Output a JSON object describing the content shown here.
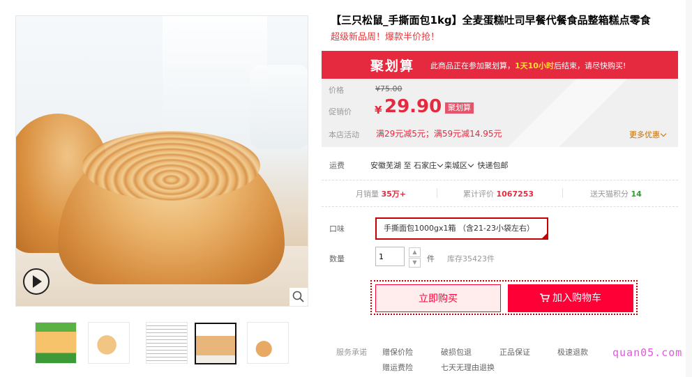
{
  "product": {
    "title": "【三只松鼠_手撕面包1kg】全麦蛋糕吐司早餐代餐食品整箱糕点零食",
    "subtitle": "超级新品周！爆款半价抢！"
  },
  "promo_banner": {
    "logo": "聚划算",
    "text_before": "此商品正在参加聚划算，",
    "highlight": "1天10小时",
    "text_after": "后结束，请尽快购买!"
  },
  "price": {
    "label": "价格",
    "original": "¥75.00",
    "promo_label": "促销价",
    "currency": "¥",
    "promo_value": "29.90",
    "tag": "聚划算",
    "activity_label": "本店活动",
    "activity_text": "满29元减5元；满59元减14.95元",
    "more_offers": "更多优惠"
  },
  "shipping": {
    "label": "运费",
    "origin": "安徽芜湖",
    "to": "至",
    "city": "石家庄",
    "district": "栾城区",
    "method": "快递包邮"
  },
  "stats": {
    "monthly_sales_label": "月销量",
    "monthly_sales_value": "35万+",
    "reviews_label": "累计评价",
    "reviews_value": "1067253",
    "points_label": "送天猫积分",
    "points_value": "14"
  },
  "options": {
    "flavor_label": "口味",
    "flavor_value": "手撕面包1000gx1箱 （含21-23小袋左右）",
    "qty_label": "数量",
    "qty_value": "1",
    "qty_unit": "件",
    "stock": "库存35423件"
  },
  "buttons": {
    "buy_now": "立即购买",
    "add_cart": "加入购物车"
  },
  "service": {
    "label": "服务承诺",
    "items": [
      "赠保价险",
      "破损包退",
      "正品保证",
      "极速退款",
      "赠运费险",
      "七天无理由退换"
    ],
    "watermark": "quan05.com"
  },
  "icons": {
    "play": "play-icon",
    "zoom": "magnifier-icon",
    "cart": "cart-icon"
  },
  "colors": {
    "brand_red": "#e5293f",
    "tmall_red": "#ff0036",
    "promo_yellow": "#ffe12b"
  }
}
